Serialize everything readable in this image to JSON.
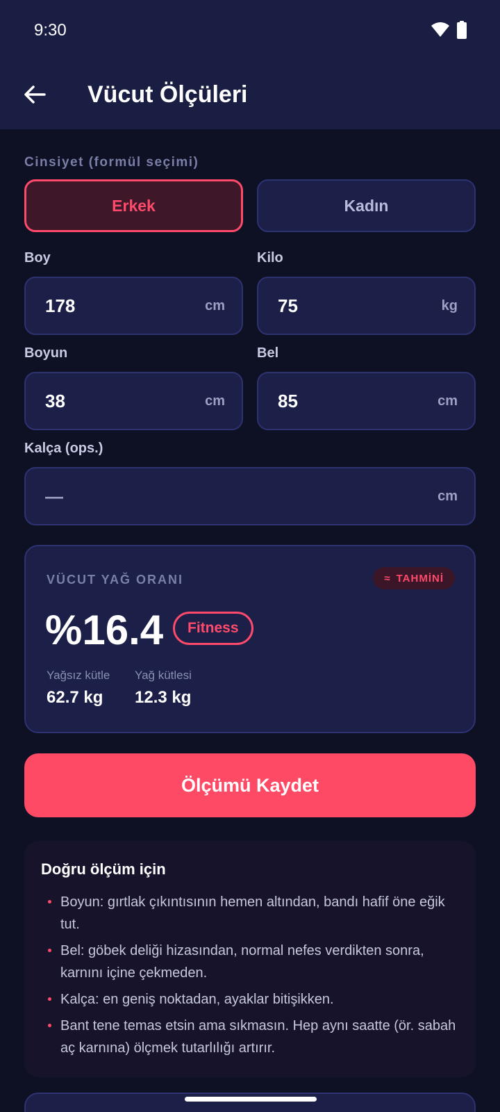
{
  "status_bar": {
    "time": "9:30",
    "wifi_icon": "wifi-icon",
    "battery_icon": "battery-icon"
  },
  "header": {
    "title": "Vücut Ölçüleri",
    "back_icon": "arrow-left-icon"
  },
  "gender": {
    "label": "Cinsiyet (formül seçimi)",
    "options": [
      "Erkek",
      "Kadın"
    ],
    "selected": "Erkek"
  },
  "fields": {
    "height": {
      "label": "Boy",
      "value": "178",
      "unit": "cm"
    },
    "weight": {
      "label": "Kilo",
      "value": "75",
      "unit": "kg"
    },
    "neck": {
      "label": "Boyun",
      "value": "38",
      "unit": "cm"
    },
    "waist": {
      "label": "Bel",
      "value": "85",
      "unit": "cm"
    },
    "hip": {
      "label": "Kalça (ops.)",
      "value": "—",
      "unit": "cm"
    }
  },
  "result": {
    "title": "VÜCUT YAĞ ORANI",
    "badge": "TAHMİNİ",
    "badge_symbol": "≈",
    "value": "%16.4",
    "category": "Fitness",
    "lean_mass_label": "Yağsız kütle",
    "lean_mass_value": "62.7 kg",
    "fat_mass_label": "Yağ kütlesi",
    "fat_mass_value": "12.3 kg"
  },
  "save_button": "Ölçümü Kaydet",
  "tips": {
    "title": "Doğru ölçüm için",
    "items": [
      "Boyun: gırtlak çıkıntısının hemen altından, bandı hafif öne eğik tut.",
      "Bel: göbek deliği hizasından, normal nefes verdikten sonra, karnını içine çekmeden.",
      "Kalça: en geniş noktadan, ayaklar bitişikken.",
      "Bant tene temas etsin ama sıkmasın. Hep aynı saatte (ör. sabah aç karnına) ölçmek tutarlılığı artırır."
    ]
  },
  "colors": {
    "accent": "#ff4a66",
    "background": "#0e1024",
    "surface": "#1c2048",
    "appbar": "#1a1e42"
  }
}
